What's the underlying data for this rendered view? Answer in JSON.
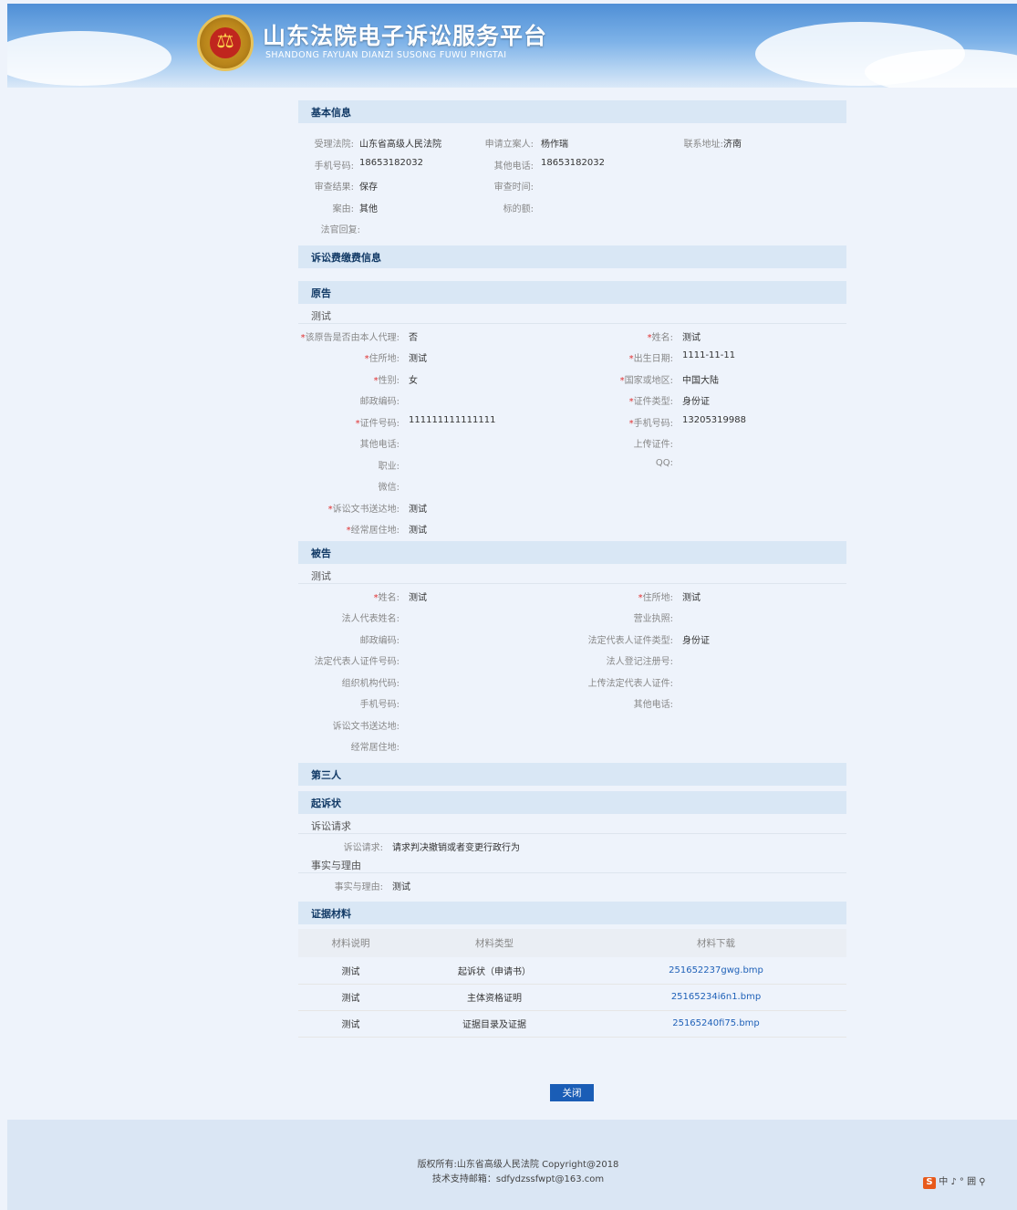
{
  "header": {
    "title": "山东法院电子诉讼服务平台",
    "subtitle": "SHANDONG FAYUAN DIANZI SUSONG FUWU PINGTAI"
  },
  "basic": {
    "section_title": "基本信息",
    "court_label": "受理法院:",
    "court_value": "山东省高级人民法院",
    "applicant_label": "申请立案人:",
    "applicant_value": "杨作瑞",
    "address_label": "联系地址:",
    "address_value": "济南",
    "phone_label": "手机号码:",
    "phone_value": "18653182032",
    "other_phone_label": "其他电话:",
    "other_phone_value": "18653182032",
    "review_result_label": "审查结果:",
    "review_result_value": "保存",
    "review_time_label": "审查时间:",
    "cause_label": "案由:",
    "cause_value": "其他",
    "amount_label": "标的额:",
    "reply_label": "法官回复:"
  },
  "fee": {
    "section_title": "诉讼费缴费信息"
  },
  "plaintiff": {
    "section_title": "原告",
    "name_head": "测试",
    "self_agent_label": "该原告是否由本人代理:",
    "self_agent_value": "否",
    "name_label": "姓名:",
    "name_value": "测试",
    "residence_label": "住所地:",
    "residence_value": "测试",
    "birth_label": "出生日期:",
    "birth_value": "1111-11-11",
    "gender_label": "性别:",
    "gender_value": "女",
    "region_label": "国家或地区:",
    "region_value": "中国大陆",
    "postal_label": "邮政编码:",
    "id_type_label": "证件类型:",
    "id_type_value": "身份证",
    "id_no_label": "证件号码:",
    "id_no_value": "111111111111111",
    "mobile_label": "手机号码:",
    "mobile_value": "13205319988",
    "other_phone_label": "其他电话:",
    "upload_label": "上传证件:",
    "job_label": "职业:",
    "qq_label": "QQ:",
    "wechat_label": "微信:",
    "delivery_label": "诉讼文书送达地:",
    "delivery_value": "测试",
    "habitual_label": "经常居住地:",
    "habitual_value": "测试"
  },
  "defendant": {
    "section_title": "被告",
    "name_head": "测试",
    "name_label": "姓名:",
    "name_value": "测试",
    "residence_label": "住所地:",
    "residence_value": "测试",
    "legal_rep_label": "法人代表姓名:",
    "license_label": "营业执照:",
    "postal_label": "邮政编码:",
    "rep_id_type_label": "法定代表人证件类型:",
    "rep_id_type_value": "身份证",
    "rep_id_no_label": "法定代表人证件号码:",
    "reg_no_label": "法人登记注册号:",
    "org_code_label": "组织机构代码:",
    "upload_rep_label": "上传法定代表人证件:",
    "mobile_label": "手机号码:",
    "other_phone_label": "其他电话:",
    "delivery_label": "诉讼文书送达地:",
    "habitual_label": "经常居住地:"
  },
  "third": {
    "section_title": "第三人"
  },
  "complaint": {
    "section_title": "起诉状",
    "claims_head": "诉讼请求",
    "claims_label": "诉讼请求:",
    "claims_value": "请求判决撤销或者变更行政行为",
    "facts_head": "事实与理由",
    "facts_label": "事实与理由:",
    "facts_value": "测试"
  },
  "evidence": {
    "section_title": "证据材料",
    "columns": [
      "材料说明",
      "材料类型",
      "材料下载"
    ],
    "rows": [
      [
        "测试",
        "起诉状（申请书）",
        "251652237gwg.bmp"
      ],
      [
        "测试",
        "主体资格证明",
        "25165234i6n1.bmp"
      ],
      [
        "测试",
        "证据目录及证据",
        "25165240fi75.bmp"
      ]
    ]
  },
  "close_label": "关闭",
  "footer": {
    "copyright": "版权所有:山东省高级人民法院 Copyright@2018",
    "support": "技术支持邮箱：sdfydzssfwpt@163.com"
  },
  "ime": {
    "logo": "S",
    "text": "中 ♪ ° 囲 ⚲"
  }
}
